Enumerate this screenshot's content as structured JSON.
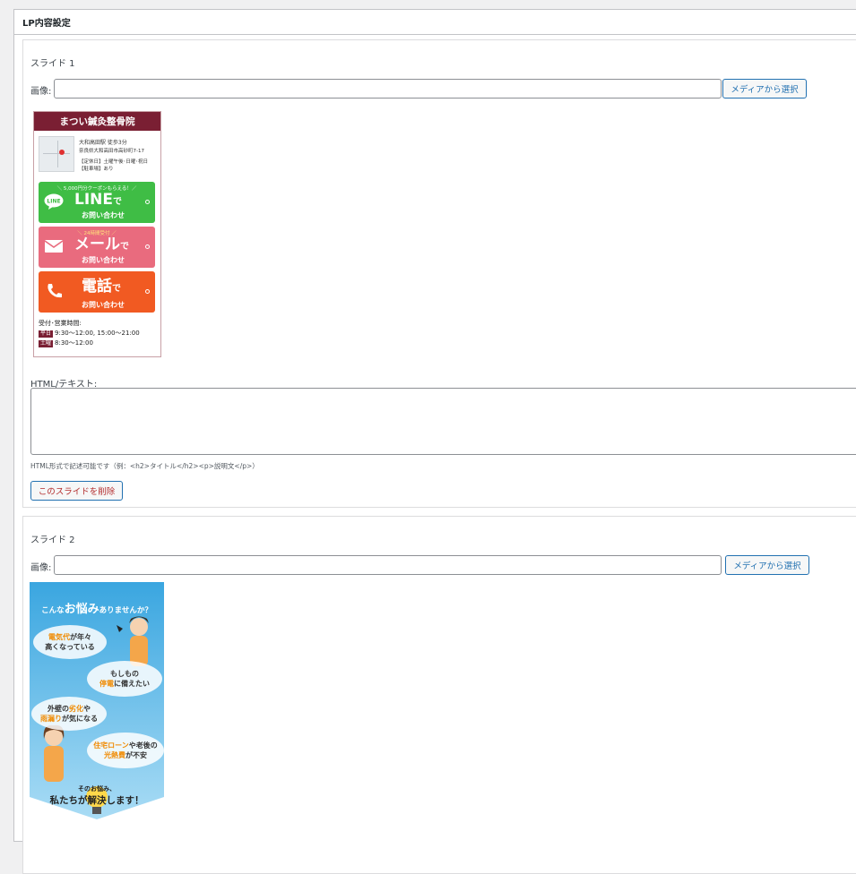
{
  "panel": {
    "title": "LP内容設定"
  },
  "slides": [
    {
      "title": "スライド 1",
      "image_label": "画像:",
      "image_value": "",
      "media_button": "メディアから選択",
      "html_label": "HTML/テキスト:",
      "html_value": "",
      "hint": "HTML形式で記述可能です（例：<h2>タイトル</h2><p>説明文</p>）",
      "delete_button": "このスライドを削除",
      "preview": {
        "clinic_name": "まつい鍼灸整骨院",
        "station": "大和高田駅 徒歩3分",
        "address": "奈良県大和高田市高砂町7-17",
        "closed": "【定休日】土曜午後･日曜･祝日",
        "parking": "【駐車場】あり",
        "line_sub": "＼ 5,000円分クーポンもらえる！／",
        "line_main": "LINE",
        "line_icon_text": "LINE",
        "mail_sub": "＼ 24時間受付 ／",
        "mail_main": "メール",
        "tel_main": "電話",
        "de": "で",
        "contact": "お問い合わせ",
        "hours_label": "受付･営業時間:",
        "weekday_tag": "平日",
        "weekday_hours": "9:30〜12:00, 15:00〜21:00",
        "sat_tag": "土曜",
        "sat_hours": "8:30〜12:00",
        "colors": {
          "header": "#7a1f33",
          "line": "#3fbd45",
          "mail": "#e96b7e",
          "tel": "#f15a22"
        }
      }
    },
    {
      "title": "スライド 2",
      "image_label": "画像:",
      "image_value": "",
      "media_button": "メディアから選択",
      "preview": {
        "headline_pre": "こんな",
        "headline_em": "お悩み",
        "headline_post": "ありませんか？",
        "b1_em": "電気代",
        "b1_a": "が年々",
        "b1_b": "高くなっている",
        "b2_a": "もしもの",
        "b2_em": "停電",
        "b2_b": "に備えたい",
        "b3_a": "外壁の",
        "b3_em1": "劣化",
        "b3_b": "や",
        "b3_em2": "雨漏り",
        "b3_c": "が気になる",
        "b4_em1": "住宅ローン",
        "b4_a": "や老後の",
        "b4_em2": "光熱費",
        "b4_b": "が不安",
        "footer_a": "そのお悩み、",
        "footer_b": "私たちが解決します！"
      }
    }
  ]
}
